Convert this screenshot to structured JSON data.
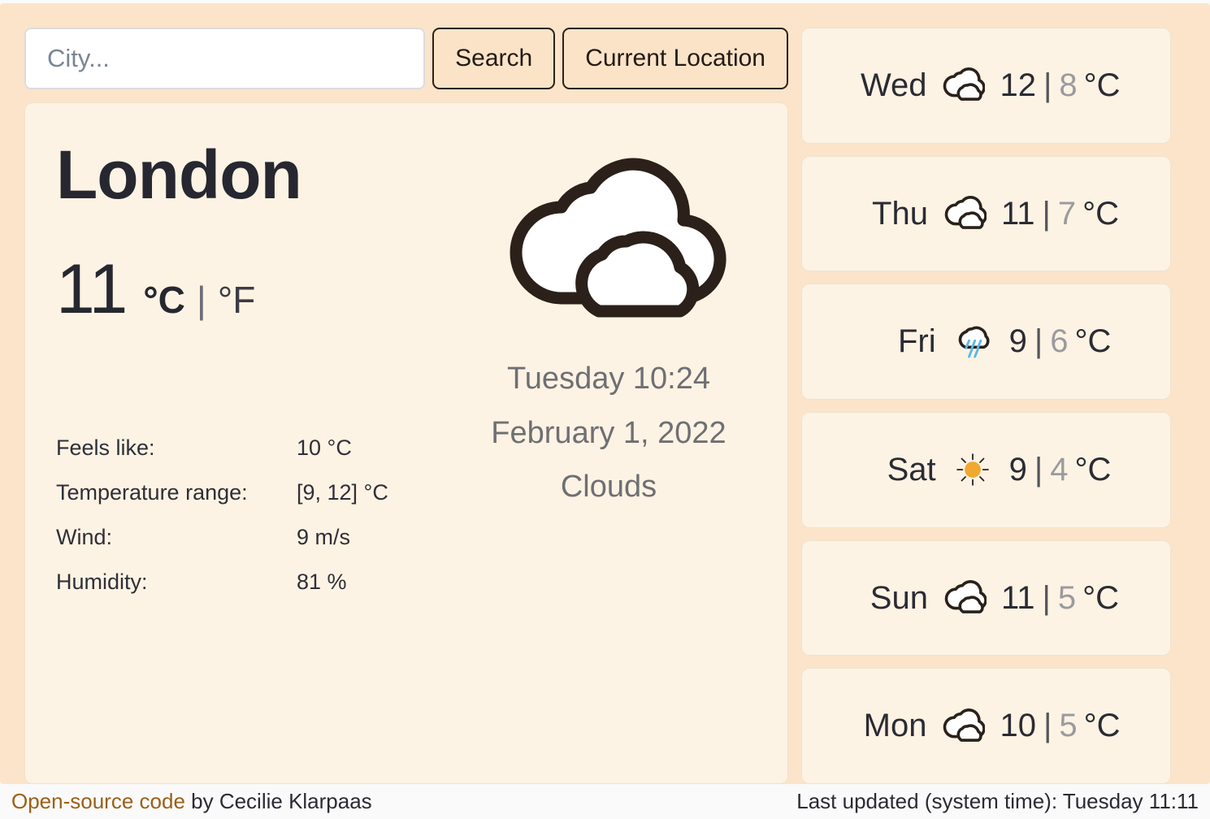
{
  "search": {
    "placeholder": "City...",
    "value": "",
    "search_label": "Search",
    "current_location_label": "Current Location"
  },
  "current": {
    "city": "London",
    "temperature": "11",
    "unit_celsius": "°C",
    "unit_separator": "|",
    "unit_fahrenheit": "°F",
    "icon": "clouds-icon",
    "details": [
      {
        "label": "Feels like:",
        "value": "10 °C"
      },
      {
        "label": "Temperature range:",
        "value": "[9, 12] °C"
      },
      {
        "label": "Wind:",
        "value": "9 m/s"
      },
      {
        "label": "Humidity:",
        "value": "81 %"
      }
    ],
    "date_time": "Tuesday 10:24",
    "date_full": "February 1, 2022",
    "condition": "Clouds"
  },
  "forecast": [
    {
      "day": "Wed",
      "icon": "clouds-icon",
      "max": "12",
      "sep": "|",
      "min": "8",
      "unit": "°C"
    },
    {
      "day": "Thu",
      "icon": "clouds-icon",
      "max": "11",
      "sep": "|",
      "min": "7",
      "unit": "°C"
    },
    {
      "day": "Fri",
      "icon": "rain-icon",
      "max": "9",
      "sep": "|",
      "min": "6",
      "unit": "°C"
    },
    {
      "day": "Sat",
      "icon": "sun-icon",
      "max": "9",
      "sep": "|",
      "min": "4",
      "unit": "°C"
    },
    {
      "day": "Sun",
      "icon": "clouds-icon",
      "max": "11",
      "sep": "|",
      "min": "5",
      "unit": "°C"
    },
    {
      "day": "Mon",
      "icon": "clouds-icon",
      "max": "10",
      "sep": "|",
      "min": "5",
      "unit": "°C"
    }
  ],
  "footer": {
    "link_text": "Open-source code",
    "author_text": " by Cecilie Klarpaas",
    "last_updated": "Last updated (system time): Tuesday 11:11"
  },
  "colors": {
    "page_background": "#FBE4CA",
    "card_background": "#FDF3E4",
    "text": "#2B2B33",
    "muted_text": "#9B9B9E",
    "sun": "#F0A830",
    "rain": "#5BB8E8",
    "link": "#9C5F17",
    "outline": "#2B2118"
  }
}
